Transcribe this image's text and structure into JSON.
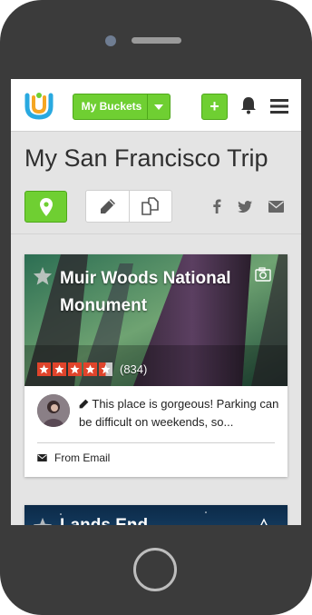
{
  "header": {
    "buckets_label": "My Buckets",
    "add_label": "+"
  },
  "page": {
    "title": "My San Francisco Trip"
  },
  "cards": [
    {
      "title": "Muir Woods National Monument",
      "rating_count": "(834)",
      "rating": 4.5,
      "comment": "This place is gorgeous! Parking can be difficult on weekends, so...",
      "source": "From Email"
    },
    {
      "title": "Lands End"
    }
  ],
  "colors": {
    "accent": "#6fcf32",
    "rating": "#e0442b"
  },
  "icons": [
    "map-marker-icon",
    "pencil-icon",
    "copy-icon",
    "facebook-icon",
    "twitter-icon",
    "envelope-icon",
    "bell-icon",
    "hamburger-icon",
    "star-icon",
    "camera-icon"
  ]
}
